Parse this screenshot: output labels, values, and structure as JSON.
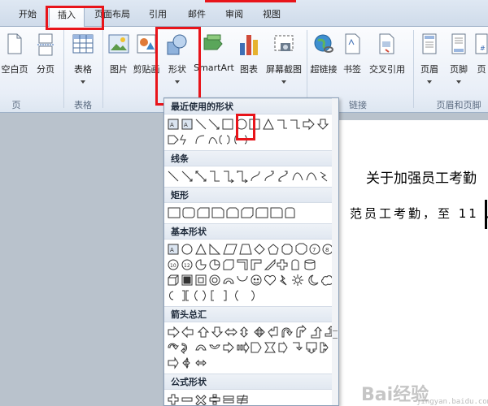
{
  "tabs": [
    {
      "label": "开始"
    },
    {
      "label": "插入"
    },
    {
      "label": "页面布局"
    },
    {
      "label": "引用"
    },
    {
      "label": "邮件"
    },
    {
      "label": "审阅"
    },
    {
      "label": "视图"
    }
  ],
  "ribbon": {
    "buttons": {
      "blank_page": "空白页",
      "page_break": "分页",
      "table": "表格",
      "picture": "图片",
      "clipart": "剪贴画",
      "shapes": "形状",
      "smartart": "SmartArt",
      "chart": "图表",
      "screenshot": "屏幕截图",
      "hyperlink": "超链接",
      "bookmark": "书签",
      "cross_reference": "交叉引用",
      "header": "页眉",
      "footer": "页脚",
      "page_number": "页"
    },
    "groups": {
      "pages": "页",
      "tables": "表格",
      "links": "链接",
      "header_footer": "页眉和页脚"
    }
  },
  "shapes_gallery": {
    "sections": [
      {
        "title": "最近使用的形状"
      },
      {
        "title": "线条"
      },
      {
        "title": "矩形"
      },
      {
        "title": "基本形状"
      },
      {
        "title": "箭头总汇"
      },
      {
        "title": "公式形状"
      }
    ]
  },
  "document": {
    "title": "关于加强员工考勤",
    "body": "范员工考勤，至 11 ,"
  },
  "watermark": {
    "text": "Bai经验",
    "sub": "jingyan.baidu.com"
  },
  "colors": {
    "highlight": "#e8141a",
    "ribbon_bg": "#e8eef7",
    "section_header_bg": "#e1e8f1"
  }
}
